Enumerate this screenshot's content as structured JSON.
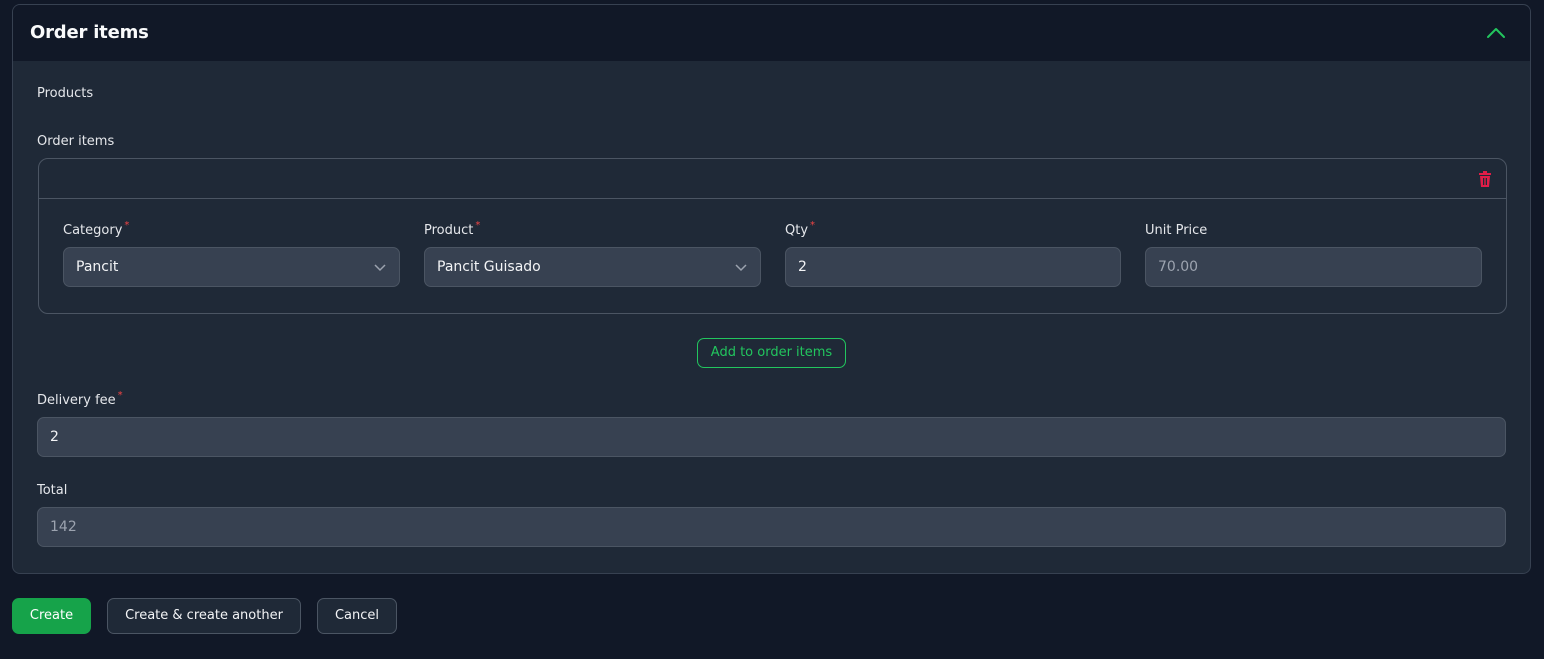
{
  "section": {
    "title": "Order items",
    "products_label": "Products",
    "order_items_label": "Order items"
  },
  "repeater": {
    "category": {
      "label": "Category",
      "value": "Pancit"
    },
    "product": {
      "label": "Product",
      "value": "Pancit Guisado"
    },
    "qty": {
      "label": "Qty",
      "value": "2"
    },
    "unit_price": {
      "label": "Unit Price",
      "value": "70.00"
    },
    "add_label": "Add to order items"
  },
  "delivery_fee": {
    "label": "Delivery fee",
    "value": "2"
  },
  "total": {
    "label": "Total",
    "value": "142"
  },
  "actions": {
    "create": "Create",
    "create_another": "Create & create another",
    "cancel": "Cancel"
  },
  "required_marker": "*",
  "colors": {
    "accent": "#22c55e",
    "danger": "#ef4444",
    "background": "#111827",
    "panel": "#1f2937",
    "input": "#374151"
  },
  "icons": {
    "collapse": "chevron-up-icon",
    "delete": "trash-icon",
    "select": "chevron-down-icon"
  }
}
